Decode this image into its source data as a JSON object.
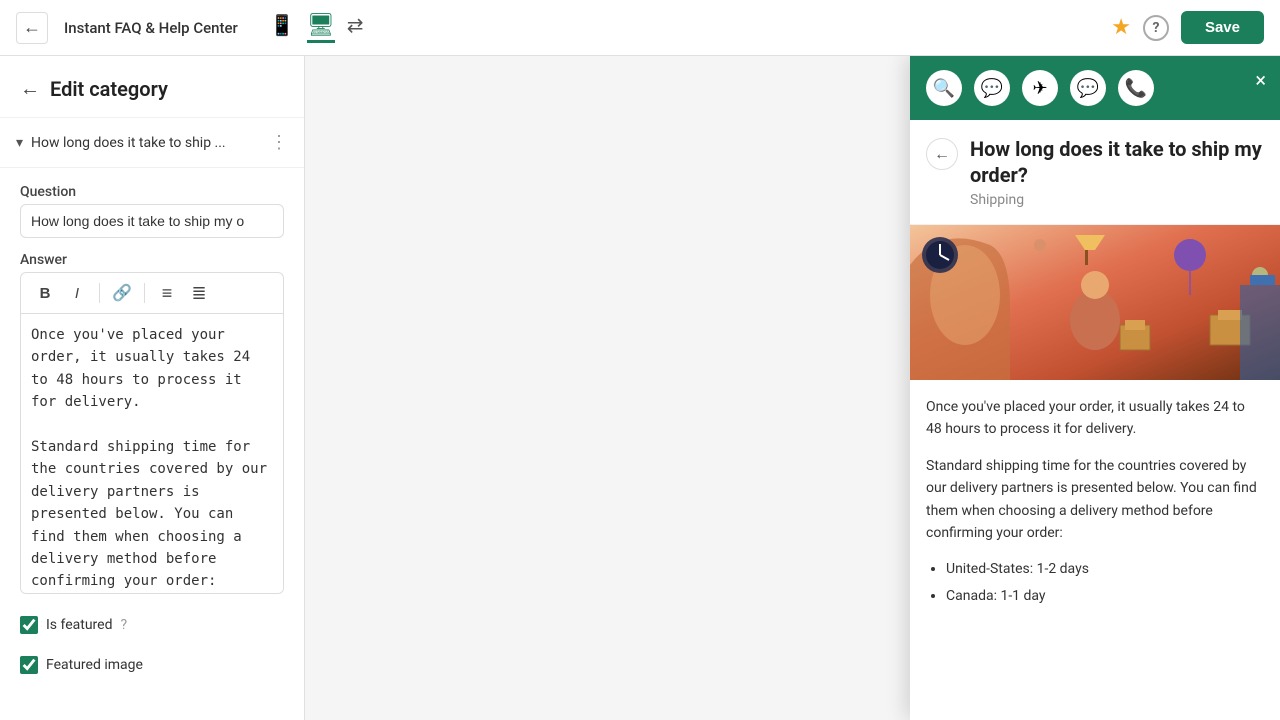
{
  "topbar": {
    "back_icon": "←",
    "app_title": "Instant FAQ & Help Center",
    "icon_mobile": "📱",
    "icon_desktop": "🖥",
    "icon_resize": "⇄",
    "star_icon": "★",
    "help_icon": "?",
    "save_label": "Save"
  },
  "sidebar": {
    "back_icon": "←",
    "title": "Edit category",
    "item": {
      "chevron": "▾",
      "label": "How long does it take to ship ...",
      "menu_icon": "⋮"
    },
    "form": {
      "question_label": "Question",
      "question_value": "How long does it take to ship my o",
      "answer_label": "Answer",
      "answer_text": "Once you've placed your order, it usually takes 24 to 48 hours to process it for delivery.\n\nStandard shipping time for the countries covered by our delivery partners is presented below. You can find them when choosing a delivery method before confirming your order:\n\n• United-States: 1-2 days\n• Canada: 1-1 day",
      "toolbar": {
        "bold": "B",
        "italic": "I",
        "link": "🔗",
        "bullet": "≡",
        "numbered": "≣"
      }
    },
    "featured_label": "Is featured",
    "featured_image_label": "Featured image",
    "info_icon": "?"
  },
  "preview": {
    "close_icon": "×",
    "icons": [
      "🔍",
      "💬",
      "✈",
      "💬",
      "📞"
    ],
    "back_icon": "←",
    "question_title": "How long does it take to ship my order?",
    "category": "Shipping",
    "answer_para1": "Once you've placed your order, it usually takes 24 to 48 hours to process it for delivery.",
    "answer_para2": "Standard shipping time for the countries covered by our delivery partners is presented below. You can find them when choosing a delivery method before confirming your order:",
    "bullets": [
      "United-States: 1-2 days",
      "Canada: 1-1 day"
    ]
  }
}
